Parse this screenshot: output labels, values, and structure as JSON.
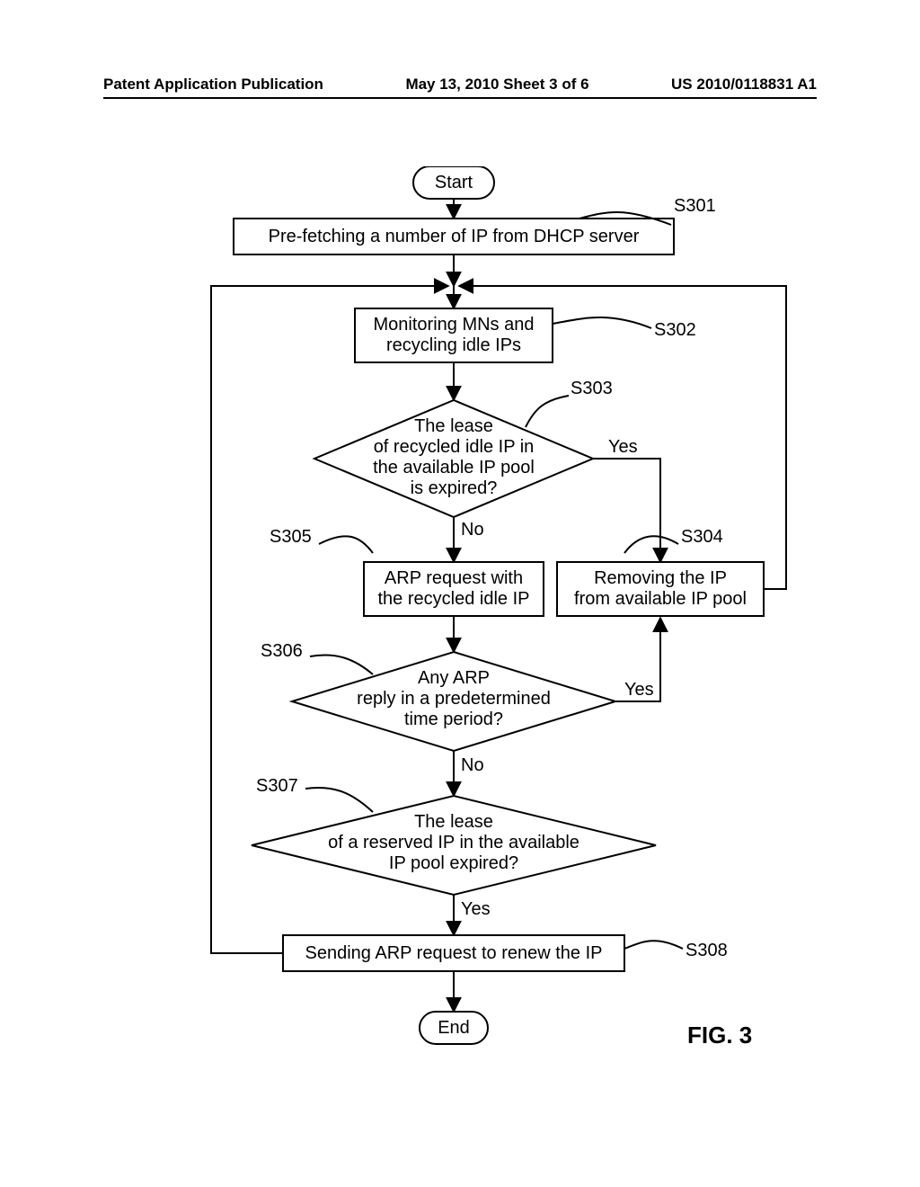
{
  "header": {
    "left": "Patent Application Publication",
    "center": "May 13, 2010  Sheet 3 of 6",
    "right": "US 2010/0118831 A1"
  },
  "figure_label": "FIG. 3",
  "nodes": {
    "start": "Start",
    "end": "End",
    "s301": {
      "ref": "S301",
      "text": "Pre-fetching a number of IP from DHCP server"
    },
    "s302": {
      "ref": "S302",
      "text1": "Monitoring MNs and",
      "text2": "recycling idle IPs"
    },
    "s303": {
      "ref": "S303",
      "text1": "The lease",
      "text2": "of recycled idle IP in",
      "text3": "the available IP pool",
      "text4": "is expired?",
      "yes": "Yes",
      "no": "No"
    },
    "s304": {
      "ref": "S304",
      "text1": "Removing the IP",
      "text2": "from available IP pool"
    },
    "s305": {
      "ref": "S305",
      "text1": "ARP request with",
      "text2": "the recycled idle IP"
    },
    "s306": {
      "ref": "S306",
      "text1": "Any ARP",
      "text2": "reply in a predetermined",
      "text3": "time period?",
      "yes": "Yes",
      "no": "No"
    },
    "s307": {
      "ref": "S307",
      "text1": "The lease",
      "text2": "of a reserved IP in the available",
      "text3": "IP pool expired?",
      "yes": "Yes"
    },
    "s308": {
      "ref": "S308",
      "text": "Sending ARP request to renew the IP"
    }
  }
}
